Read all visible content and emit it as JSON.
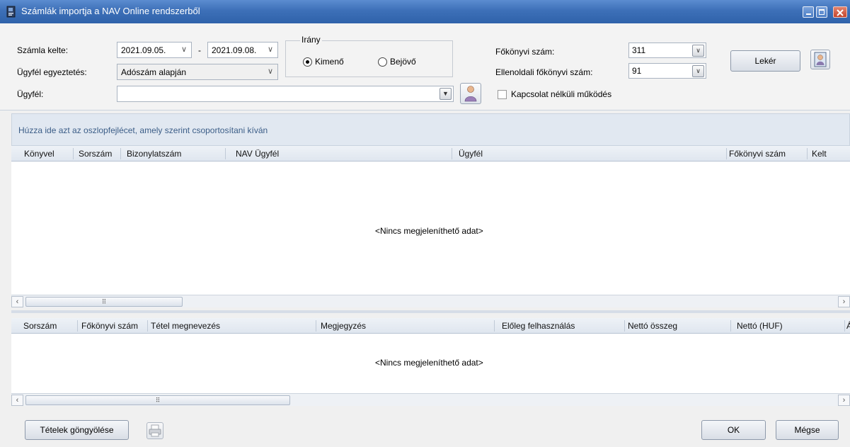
{
  "window": {
    "title": "Számlák importja a NAV Online rendszerből",
    "controls": {
      "minimize": "–",
      "maximize": "□",
      "close": "✕"
    }
  },
  "filters": {
    "date_label": "Számla kelte:",
    "date_from": "2021.09.05.",
    "date_sep": "-",
    "date_to": "2021.09.08.",
    "match_label": "Ügyfél egyeztetés:",
    "match_value": "Adószám alapján",
    "client_label": "Ügyfél:",
    "client_value": "",
    "direction": {
      "title": "Irány",
      "outgoing": "Kimenő",
      "incoming": "Bejövő",
      "selected": "Kimenő"
    },
    "ledger_label": "Főkönyvi szám:",
    "ledger_value": "311",
    "counter_ledger_label": "Ellenoldali főkönyvi szám:",
    "counter_ledger_value": "91",
    "offline_label": "Kapcsolat nélküli működés",
    "offline_checked": false,
    "fetch_button": "Lekér"
  },
  "invoices_grid": {
    "group_hint": "Húzza ide azt az oszlopfejlécet, amely szerint csoportosítani kíván",
    "columns": [
      "Könyvel",
      "Sorszám",
      "Bizonylatszám",
      "NAV Ügyfél",
      "Ügyfél",
      "Főkönyvi szám",
      "Kelt"
    ],
    "empty_text": "<Nincs megjeleníthető adat>"
  },
  "items_grid": {
    "columns": [
      "Sorszám",
      "Főkönyvi szám",
      "Tétel megnevezés",
      "Megjegyzés",
      "Előleg felhasználás",
      "Nettó összeg",
      "Nettó (HUF)",
      "Á"
    ],
    "empty_text": "<Nincs megjeleníthető adat>"
  },
  "footer": {
    "roll_button": "Tételek göngyölése",
    "ok_button": "OK",
    "ok_access_key": "K",
    "cancel_button": "Mégse",
    "cancel_access_key": "M"
  },
  "icons": {
    "app": "ledger-book-icon",
    "client_picker": "person-icon",
    "fetch_side": "person-card-icon",
    "print": "printer-icon"
  }
}
